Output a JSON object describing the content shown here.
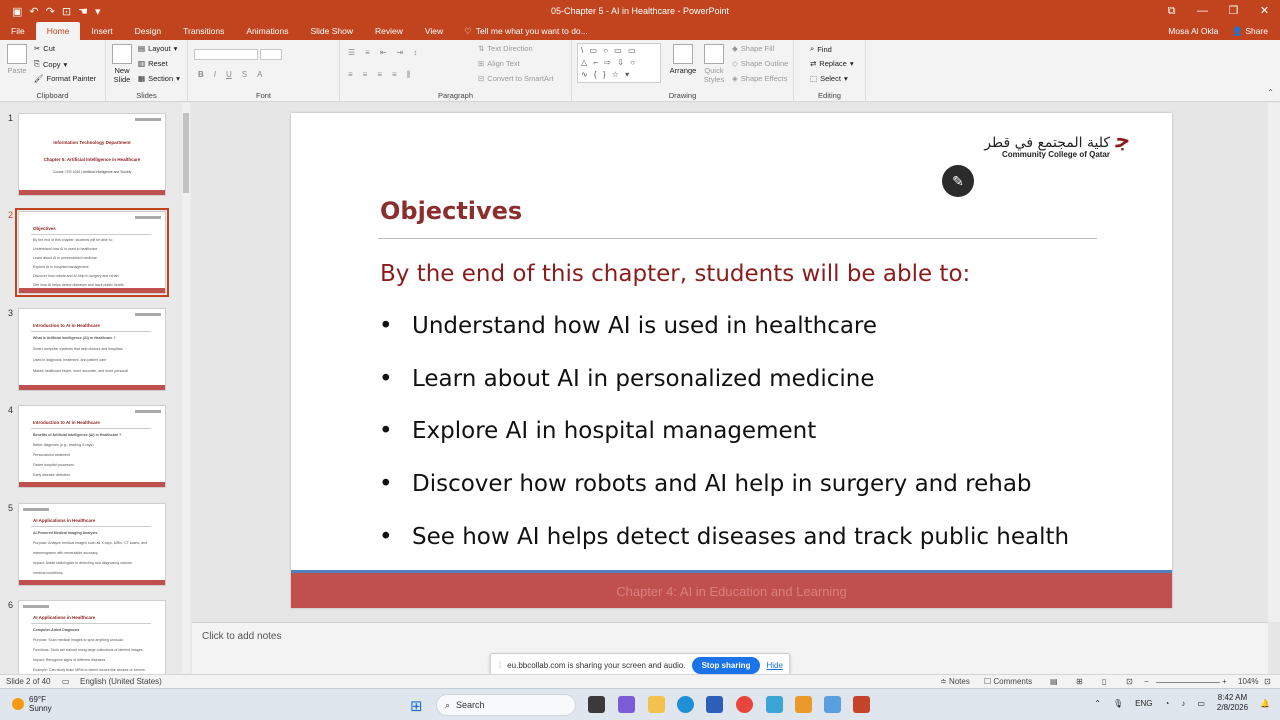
{
  "window": {
    "title": "05-Chapter 5 - AI in Healthcare - PowerPoint",
    "user": "Mosa Al Okla",
    "share": "Share"
  },
  "ribbon": {
    "tabs": [
      "File",
      "Home",
      "Insert",
      "Design",
      "Transitions",
      "Animations",
      "Slide Show",
      "Review",
      "View"
    ],
    "tell_me": "Tell me what you want to do...",
    "clipboard": {
      "paste": "Paste",
      "cut": "Cut",
      "copy": "Copy",
      "format_painter": "Format Painter",
      "label": "Clipboard"
    },
    "slides": {
      "new_slide": "New Slide",
      "layout": "Layout",
      "reset": "Reset",
      "section": "Section",
      "label": "Slides"
    },
    "font": {
      "label": "Font"
    },
    "paragraph": {
      "text_direction": "Text Direction",
      "align_text": "Align Text",
      "convert_smartart": "Convert to SmartArt",
      "label": "Paragraph"
    },
    "drawing": {
      "arrange": "Arrange",
      "quick_styles": "Quick Styles",
      "shape_fill": "Shape Fill",
      "shape_outline": "Shape Outline",
      "shape_effects": "Shape Effects",
      "label": "Drawing"
    },
    "editing": {
      "find": "Find",
      "replace": "Replace",
      "select": "Select",
      "label": "Editing"
    }
  },
  "thumbnails": [
    {
      "num": "1",
      "title": "Information Technology Department",
      "sub": "Chapter 5: Artificial Intelligence in Healthcare",
      "sub2": "Course: ITIS 1020 | Artificial Intelligence and Society"
    },
    {
      "num": "2",
      "title": "Objectives",
      "lines": [
        "By the end of this chapter, students will be able to:",
        "Understand how AI is used in healthcare",
        "Learn about AI in personalized medicine",
        "Explore AI in hospital management",
        "Discover how robots and AI help in surgery and rehab",
        "See how AI helps detect diseases and track public health"
      ]
    },
    {
      "num": "3",
      "title": "Introduction to AI in Healthcare",
      "lines": [
        "What is Artificial Intelligence (AI) in Healthcare ?",
        "Smart computer systems that help doctors and hospitals",
        "Used in diagnosis, treatment, and patient care",
        "Makes healthcare faster, more accurate, and more personal"
      ]
    },
    {
      "num": "4",
      "title": "Introduction to AI in Healthcare",
      "lines": [
        "Benefits of Artificial Intelligence (AI) in Healthcare ?",
        "Better diagnosis (e.g., reading X-rays)",
        "Personalized treatment",
        "Faster hospital processes",
        "Early disease detection"
      ]
    },
    {
      "num": "5",
      "title": "AI Applications in Healthcare",
      "lines": [
        "AI-Powered Medical Imaging Analysis",
        "Purpose: Analyze medical images such as X-rays, MRIs, CT scans, and",
        "mammograms with remarkable accuracy.",
        "Impact: Assist radiologists in detecting and diagnosing various",
        "medical conditions."
      ]
    },
    {
      "num": "6",
      "title": "AI Applications in Healthcare",
      "lines": [
        "Computer-Aided Diagnosis",
        "Purpose: Scan medical images to spot anything unusual.",
        "Functions: Tools are trained using large collections of labeled images.",
        "Impact: Recognize signs of different diseases.",
        "Example: Can study brain MRIs to detect issues like strokes or tumors."
      ]
    }
  ],
  "slide": {
    "logo_ar": "كلية المجتمع في قطر",
    "logo_en": "Community College of Qatar",
    "title": "Objectives",
    "subheading": "By the end of this chapter, students will be able to:",
    "bullets": [
      "Understand how AI is used in healthcare",
      "Learn about AI in personalized medicine",
      "Explore AI in hospital management",
      "Discover how robots and AI help in surgery and rehab",
      "See how AI helps detect diseases and track public health"
    ],
    "footer": "Chapter 4: AI in Education and Learning"
  },
  "notes": {
    "placeholder": "Click to add notes"
  },
  "share_banner": {
    "text": "eu.bbcollab.com is sharing your screen and audio.",
    "stop": "Stop sharing",
    "hide": "Hide"
  },
  "status": {
    "slide": "Slide 2 of 40",
    "language": "English (United States)",
    "notes": "Notes",
    "comments": "Comments",
    "zoom": "104%"
  },
  "taskbar": {
    "temp": "69°F",
    "weather": "Sunny",
    "search": "Search",
    "lang": "ENG",
    "time": "8:42 AM",
    "date": "2/8/2026"
  },
  "colors": {
    "accent": "#c1441e",
    "slide_title": "#8b2e2e",
    "footer": "#c0504d"
  }
}
